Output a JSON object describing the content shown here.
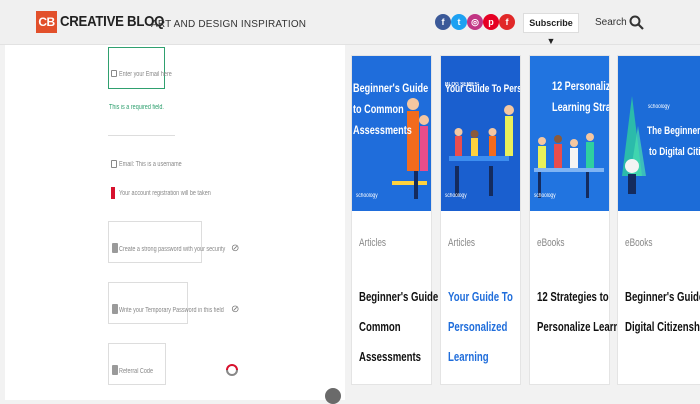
{
  "header": {
    "logo_mark": "CB",
    "logo_text": "CREATIVE BLOQ",
    "tagline": "ART AND DESIGN INSPIRATION",
    "subscribe_label": "Subscribe ▼",
    "search_label": "Search",
    "social": [
      {
        "name": "facebook",
        "glyph": "f",
        "color": "#3b5998"
      },
      {
        "name": "twitter",
        "glyph": "t",
        "color": "#1da1f2"
      },
      {
        "name": "instagram",
        "glyph": "◎",
        "color": "#c13584"
      },
      {
        "name": "pinterest",
        "glyph": "p",
        "color": "#e60023"
      },
      {
        "name": "flipboard",
        "glyph": "f",
        "color": "#e12828"
      }
    ]
  },
  "form": {
    "email_placeholder": "Enter your Email here",
    "email_note": "This is a required field.",
    "fields": [
      {
        "label": "Email: This is a username"
      },
      {
        "label": "Your account registration will be taken"
      },
      {
        "label": "Create a strong password with your security"
      },
      {
        "label": "Write your Temporary Password in this field"
      },
      {
        "label": "Referral Code"
      }
    ]
  },
  "cards": [
    {
      "thumb_title": [
        "Beginner's Guide",
        "to Common",
        "Assessments"
      ],
      "thumb_small": "",
      "brand": "schoology",
      "category": "Articles",
      "title": [
        "Beginner's Guide to",
        "Common",
        "Assessments"
      ],
      "title_color": "#111111",
      "thumb_color": "#1f6ddb"
    },
    {
      "thumb_title": [
        "Your Guide To Personalized Learning"
      ],
      "thumb_small": "BLOG SERIES:",
      "brand": "schoology",
      "category": "Articles",
      "title": [
        "Your Guide To",
        "Personalized",
        "Learning"
      ],
      "title_color": "#1f6ddb",
      "thumb_color": "#1a5fcf"
    },
    {
      "thumb_title": [
        "12 Personalized",
        "Learning Strategies"
      ],
      "thumb_small": "",
      "brand": "schoology",
      "category": "eBooks",
      "title": [
        "12 Strategies to",
        "Personalize Learning"
      ],
      "title_color": "#111111",
      "thumb_color": "#2174e0"
    },
    {
      "thumb_title": [
        "The Beginner's Guide",
        "to Digital Citizenship"
      ],
      "thumb_small": "",
      "brand": "schoology",
      "category": "eBooks",
      "title": [
        "Beginner's Guide to",
        "Digital Citizenship"
      ],
      "title_color": "#111111",
      "thumb_color": "#1c6cd8"
    }
  ]
}
